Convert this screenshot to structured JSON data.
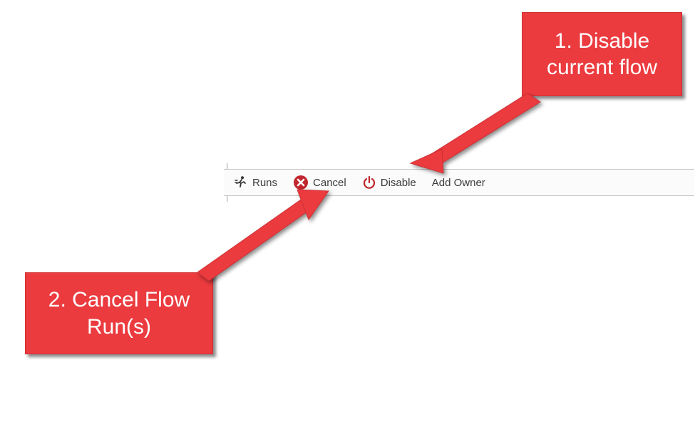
{
  "toolbar": {
    "runs_label": "Runs",
    "cancel_label": "Cancel",
    "disable_label": "Disable",
    "add_owner_label": "Add Owner"
  },
  "callouts": {
    "top": "1. Disable current flow",
    "bottom": "2. Cancel Flow Run(s)"
  },
  "colors": {
    "callout_bg": "#eb3b3f",
    "callout_text": "#ffffff",
    "icon_red": "#c1272d"
  }
}
